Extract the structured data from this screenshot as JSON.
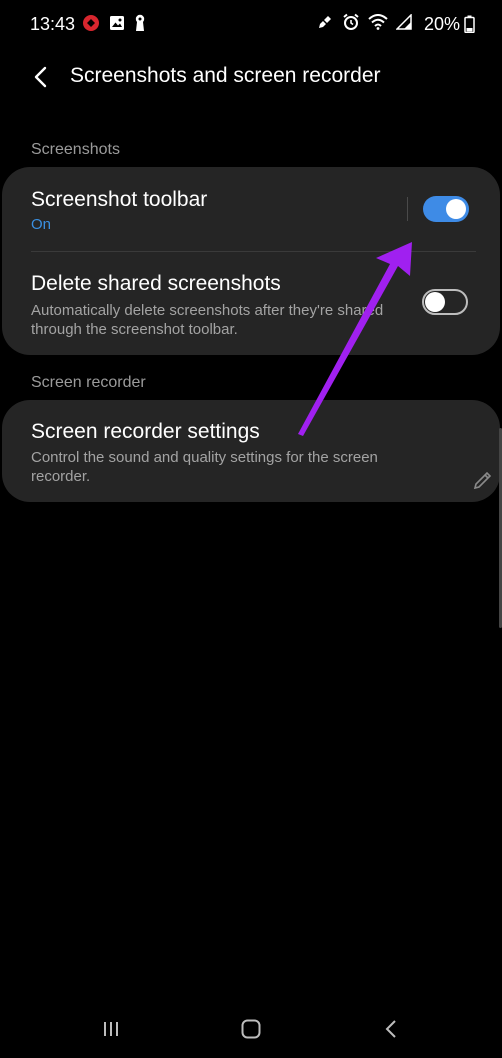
{
  "status_bar": {
    "time": "13:43",
    "battery": "20%",
    "left_icons": [
      "game-launcher-icon",
      "gallery-icon",
      "keyhole-icon"
    ],
    "right_icons": [
      "edit-icon",
      "alarm-icon",
      "wifi-icon",
      "signal-icon",
      "battery-icon"
    ]
  },
  "header": {
    "title": "Screenshots and screen recorder",
    "back_icon": "back-arrow-icon"
  },
  "sections": {
    "screenshots": {
      "label": "Screenshots",
      "items": [
        {
          "title": "Screenshot toolbar",
          "subtitle": "On",
          "toggle": true
        },
        {
          "title": "Delete shared screenshots",
          "subtitle": "Automatically delete screenshots after they're shared through the screenshot toolbar.",
          "toggle": false
        }
      ]
    },
    "screen_recorder": {
      "label": "Screen recorder",
      "items": [
        {
          "title": "Screen recorder settings",
          "subtitle": "Control the sound and quality settings for the screen recorder."
        }
      ]
    }
  },
  "colors": {
    "accent": "#3e8be6",
    "arrow": "#a020f0",
    "card": "#252525"
  },
  "nav_bar": {
    "icons": [
      "recent-apps-icon",
      "home-icon",
      "back-icon"
    ]
  }
}
